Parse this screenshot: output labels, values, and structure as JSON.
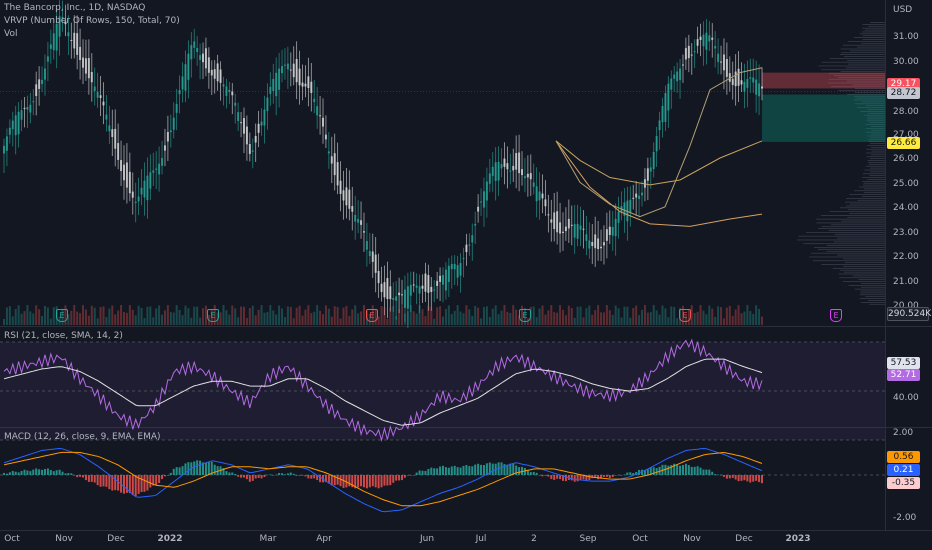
{
  "legend": {
    "symbol": "The Bancorp, Inc., 1D, NASDAQ",
    "vrvp": "VRVP (Number Of Rows, 150, Total, 70)",
    "vol": "Vol",
    "rsi": "RSI (21, close, SMA, 14, 2)",
    "macd": "MACD (12, 26, close, 9, EMA, EMA)"
  },
  "price_axis": {
    "currency": "USD",
    "ticks": [
      "31.00",
      "30.00",
      "29.00",
      "28.00",
      "27.00",
      "26.00",
      "25.00",
      "24.00",
      "23.00",
      "22.00",
      "21.00",
      "20.00"
    ],
    "tags": {
      "price_red": "29.17",
      "price_last": "28.72",
      "price_yellow": "26.66",
      "volume": "290.524K"
    }
  },
  "rsi_axis": {
    "ticks": [
      "40.00"
    ],
    "tags": {
      "sma": "57.53",
      "rsi": "52.71"
    }
  },
  "macd_axis": {
    "ticks": [
      "2.00",
      "-2.00"
    ],
    "tags": {
      "signal": "0.56",
      "macd": "0.21",
      "hist": "-0.35"
    }
  },
  "x_axis": [
    "Oct",
    "Nov",
    "Dec",
    "2022",
    "Mar",
    "Apr",
    "Jun",
    "Jul",
    "2",
    "Sep",
    "Oct",
    "Nov",
    "Dec",
    "2023"
  ],
  "earnings_badges": [
    "E",
    "E",
    "E",
    "E",
    "E",
    "E"
  ],
  "colors": {
    "up": "#26a69a",
    "down": "#ef5350",
    "rsi_line": "#b36ae2",
    "sma_line": "#e0e0e0",
    "macd_line": "#2962ff",
    "signal_line": "#ff9800",
    "yellow_tag": "#ffeb3b",
    "profile": "#5d6272"
  },
  "chart_data": {
    "type": "line",
    "price_close": [
      26.5,
      27.8,
      29.5,
      31.5,
      30.5,
      28.2,
      26.3,
      24.0,
      25.5,
      28.0,
      30.5,
      29.8,
      28.2,
      26.5,
      28.5,
      30.0,
      29.0,
      26.5,
      24.5,
      22.5,
      20.8,
      20.0,
      21.0,
      20.8,
      21.5,
      24.0,
      25.5,
      26.0,
      24.5,
      23.5,
      23.0,
      22.5,
      23.0,
      24.0,
      25.5,
      28.5,
      30.5,
      30.8,
      29.8,
      29.0,
      28.72
    ],
    "rsi": [
      58,
      60,
      62,
      64,
      55,
      48,
      40,
      36,
      44,
      58,
      60,
      56,
      50,
      45,
      56,
      60,
      52,
      44,
      38,
      34,
      32,
      35,
      40,
      48,
      46,
      52,
      60,
      64,
      60,
      56,
      52,
      49,
      48,
      50,
      56,
      64,
      70,
      66,
      60,
      54,
      52.71
    ],
    "rsi_sma": [
      55,
      57,
      59,
      60,
      58,
      54,
      49,
      44,
      44,
      48,
      52,
      54,
      54,
      52,
      52,
      55,
      55,
      51,
      46,
      42,
      38,
      36,
      37,
      41,
      44,
      47,
      52,
      57,
      59,
      58,
      56,
      53,
      51,
      50,
      51,
      55,
      60,
      63,
      63,
      60,
      57.53
    ],
    "macd": [
      0.6,
      0.9,
      1.2,
      1.3,
      1.0,
      0.4,
      -0.3,
      -1.1,
      -1.0,
      -0.3,
      0.4,
      0.7,
      0.5,
      0.1,
      0.3,
      0.5,
      0.3,
      -0.3,
      -0.9,
      -1.4,
      -1.8,
      -1.7,
      -1.3,
      -0.9,
      -0.6,
      -0.2,
      0.3,
      0.6,
      0.4,
      0.1,
      -0.2,
      -0.3,
      -0.3,
      -0.1,
      0.3,
      0.8,
      1.2,
      1.3,
      1.0,
      0.6,
      0.21
    ],
    "signal": [
      0.5,
      0.7,
      0.9,
      1.1,
      1.1,
      0.9,
      0.5,
      -0.1,
      -0.5,
      -0.6,
      -0.3,
      0.1,
      0.4,
      0.4,
      0.3,
      0.4,
      0.4,
      0.1,
      -0.3,
      -0.8,
      -1.2,
      -1.5,
      -1.5,
      -1.3,
      -1.0,
      -0.7,
      -0.3,
      0.1,
      0.3,
      0.3,
      0.1,
      -0.1,
      -0.2,
      -0.2,
      0.0,
      0.3,
      0.7,
      1.0,
      1.1,
      0.9,
      0.56
    ]
  }
}
